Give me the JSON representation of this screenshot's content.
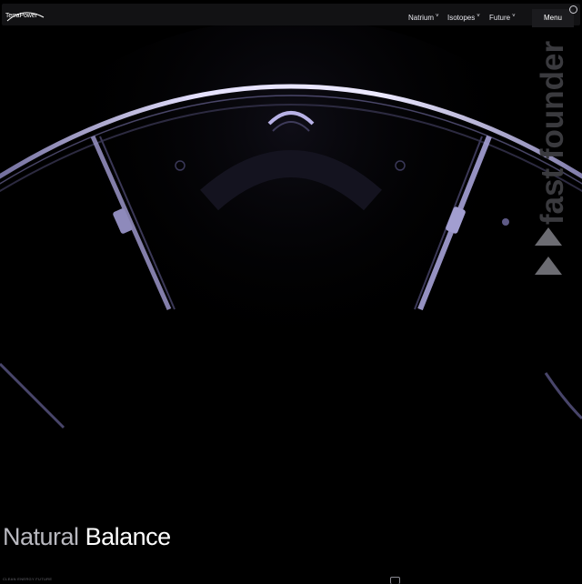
{
  "brand": {
    "name": "TerraPower"
  },
  "nav": {
    "items": [
      {
        "label": "Natrium",
        "caret": "˅"
      },
      {
        "label": "Isotopes",
        "caret": "˅"
      },
      {
        "label": "Future",
        "caret": "˅"
      }
    ],
    "menu_label": "Menu",
    "search_icon": "search-icon"
  },
  "watermark": {
    "text": "fast founder"
  },
  "hero": {
    "headline_light": "Natural",
    "headline_bold": "Balance",
    "tagline": "CLEAN ENERGY FUTURE"
  },
  "colors": {
    "background": "#000000",
    "topbar": "#121214",
    "ring_highlight": "#d9d4ff",
    "ring_shadow": "#4b4870"
  }
}
